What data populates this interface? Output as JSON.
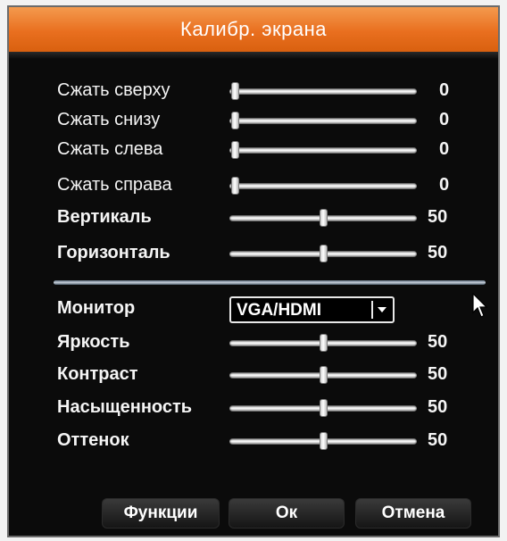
{
  "title": "Калибр. экрана",
  "sliders_top": [
    {
      "label": "Сжать сверху",
      "value": "0",
      "level": 0
    },
    {
      "label": "Сжать снизу",
      "value": "0",
      "level": 0
    },
    {
      "label": "Сжать слева",
      "value": "0",
      "level": 0
    },
    {
      "label": "Сжать справа",
      "value": "0",
      "level": 0
    },
    {
      "label": "Вертикаль",
      "value": "50",
      "level": 0.5
    },
    {
      "label": "Горизонталь",
      "value": "50",
      "level": 0.5
    }
  ],
  "monitor": {
    "label": "Монитор",
    "value": "VGA/HDMI",
    "icon": "chevron-down-icon"
  },
  "sliders_bottom": [
    {
      "label": "Яркость",
      "value": "50",
      "level": 0.5
    },
    {
      "label": "Контраст",
      "value": "50",
      "level": 0.5
    },
    {
      "label": "Насыщенность",
      "value": "50",
      "level": 0.5
    },
    {
      "label": "Оттенок",
      "value": "50",
      "level": 0.5
    }
  ],
  "buttons": {
    "functions": "Функции",
    "ok": "Ок",
    "cancel": "Отмена"
  },
  "colors": {
    "title_bar": "#e96f1f",
    "background": "#0b0b0b",
    "text": "#f5f5f5"
  }
}
